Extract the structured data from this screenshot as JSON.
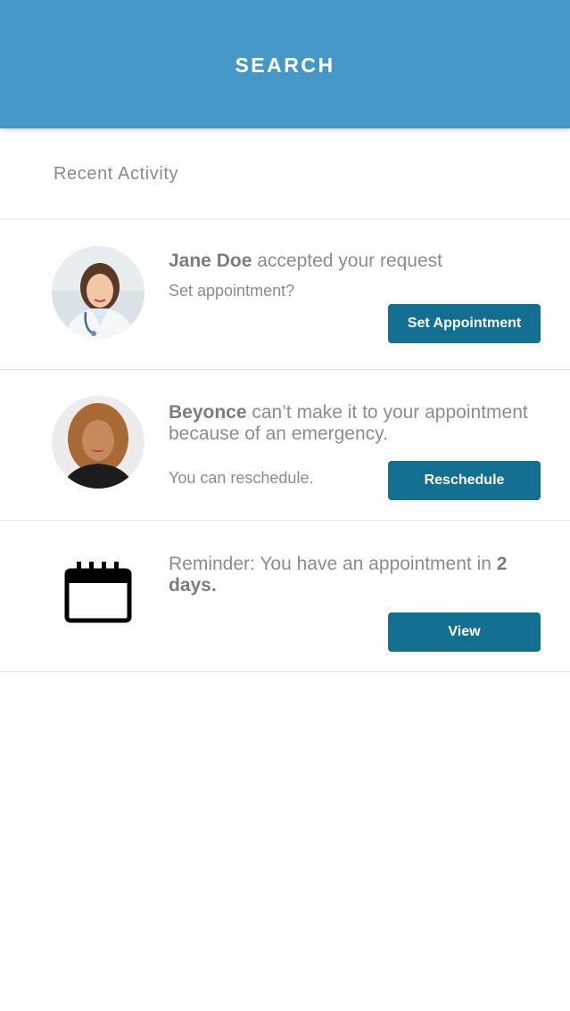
{
  "header": {
    "title": "SEARCH"
  },
  "section": {
    "title": "Recent Activity"
  },
  "activities": [
    {
      "name": "Jane Doe",
      "message": " accepted your request",
      "subtext": "Set appointment?",
      "button": "Set Appointment"
    },
    {
      "name": "Beyonce",
      "message": " can’t make it to your appointment because of an emergency.",
      "subtext": "You can reschedule.",
      "button": "Reschedule"
    },
    {
      "icon": "calendar-icon",
      "message": "Reminder: You have an appointment in ",
      "highlight": "2 days.",
      "button": "View"
    }
  ],
  "colors": {
    "header": "#4597c6",
    "button": "#126f91",
    "divider": "#e2e2e2",
    "text": "#8c8c8c"
  }
}
